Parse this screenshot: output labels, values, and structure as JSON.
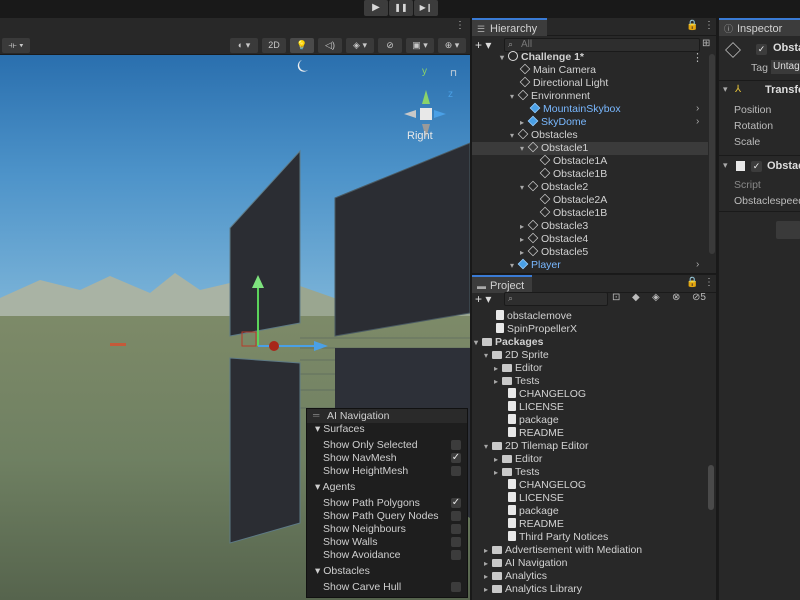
{
  "playbar": {
    "play": "▶",
    "pause": "❚❚",
    "step": "▶❙"
  },
  "scene": {
    "toolbar": {
      "view_2d": "2D"
    },
    "gizmo": {
      "axis_y": "y",
      "axis_z": "z",
      "view_label": "Right"
    }
  },
  "hierarchy": {
    "tab_label": "Hierarchy",
    "search_placeholder": "All",
    "items": [
      {
        "label": "Challenge 1*"
      },
      {
        "label": "Main Camera"
      },
      {
        "label": "Directional Light"
      },
      {
        "label": "Environment"
      },
      {
        "label": "MountainSkybox"
      },
      {
        "label": "SkyDome"
      },
      {
        "label": "Obstacles"
      },
      {
        "label": "Obstacle1"
      },
      {
        "label": "Obstacle1A"
      },
      {
        "label": "Obstacle1B"
      },
      {
        "label": "Obstacle2"
      },
      {
        "label": "Obstacle2A"
      },
      {
        "label": "Obstacle1B"
      },
      {
        "label": "Obstacle3"
      },
      {
        "label": "Obstacle4"
      },
      {
        "label": "Obstacle5"
      },
      {
        "label": "Player"
      }
    ]
  },
  "project": {
    "tab_label": "Project",
    "filter_count": "5",
    "items": [
      {
        "label": "obstaclemove"
      },
      {
        "label": "SpinPropellerX"
      },
      {
        "label": "Packages"
      },
      {
        "label": "2D Sprite"
      },
      {
        "label": "Editor"
      },
      {
        "label": "Tests"
      },
      {
        "label": "CHANGELOG"
      },
      {
        "label": "LICENSE"
      },
      {
        "label": "package"
      },
      {
        "label": "README"
      },
      {
        "label": "2D Tilemap Editor"
      },
      {
        "label": "Editor"
      },
      {
        "label": "Tests"
      },
      {
        "label": "CHANGELOG"
      },
      {
        "label": "LICENSE"
      },
      {
        "label": "package"
      },
      {
        "label": "README"
      },
      {
        "label": "Third Party Notices"
      },
      {
        "label": "Advertisement with Mediation"
      },
      {
        "label": "AI Navigation"
      },
      {
        "label": "Analytics"
      },
      {
        "label": "Analytics Library"
      }
    ]
  },
  "inspector": {
    "tab_label": "Inspector",
    "object_name": "Obsta",
    "tag_label": "Tag",
    "tag_value": "Untag",
    "transform_label": "Transfo",
    "position_label": "Position",
    "rotation_label": "Rotation",
    "scale_label": "Scale",
    "script_component": "Obstac",
    "script_label": "Script",
    "speed_label": "Obstaclespeed"
  },
  "nav_overlay": {
    "title": "AI Navigation",
    "surfaces": "Surfaces",
    "show_only_selected": "Show Only Selected",
    "show_navmesh": "Show NavMesh",
    "show_heightmesh": "Show HeightMesh",
    "agents": "Agents",
    "show_path_polygons": "Show Path Polygons",
    "show_path_query_nodes": "Show Path Query Nodes",
    "show_neighbours": "Show Neighbours",
    "show_walls": "Show Walls",
    "show_avoidance": "Show Avoidance",
    "obstacles": "Obstacles",
    "show_carve_hull": "Show Carve Hull",
    "check": "✓"
  }
}
